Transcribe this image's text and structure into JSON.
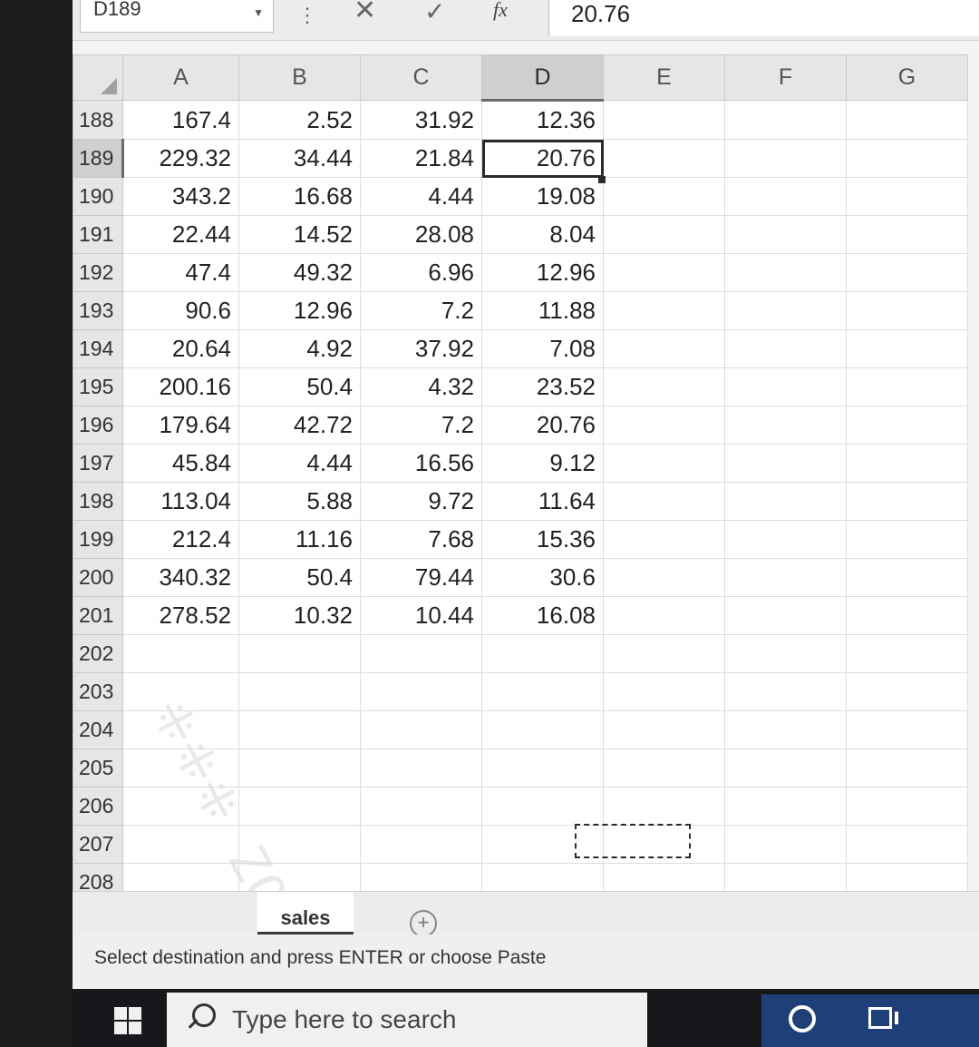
{
  "formula_bar": {
    "name_box": "D189",
    "fx_label": "fx",
    "formula_value": "20.76"
  },
  "columns": [
    "A",
    "B",
    "C",
    "D",
    "E",
    "F",
    "G"
  ],
  "selected_column": "D",
  "selected_row": "189",
  "rows": [
    {
      "row": "188",
      "cells": [
        "167.4",
        "2.52",
        "31.92",
        "12.36"
      ]
    },
    {
      "row": "189",
      "cells": [
        "229.32",
        "34.44",
        "21.84",
        "20.76"
      ]
    },
    {
      "row": "190",
      "cells": [
        "343.2",
        "16.68",
        "4.44",
        "19.08"
      ]
    },
    {
      "row": "191",
      "cells": [
        "22.44",
        "14.52",
        "28.08",
        "8.04"
      ]
    },
    {
      "row": "192",
      "cells": [
        "47.4",
        "49.32",
        "6.96",
        "12.96"
      ]
    },
    {
      "row": "193",
      "cells": [
        "90.6",
        "12.96",
        "7.2",
        "11.88"
      ]
    },
    {
      "row": "194",
      "cells": [
        "20.64",
        "4.92",
        "37.92",
        "7.08"
      ]
    },
    {
      "row": "195",
      "cells": [
        "200.16",
        "50.4",
        "4.32",
        "23.52"
      ]
    },
    {
      "row": "196",
      "cells": [
        "179.64",
        "42.72",
        "7.2",
        "20.76"
      ]
    },
    {
      "row": "197",
      "cells": [
        "45.84",
        "4.44",
        "16.56",
        "9.12"
      ]
    },
    {
      "row": "198",
      "cells": [
        "113.04",
        "5.88",
        "9.72",
        "11.64"
      ]
    },
    {
      "row": "199",
      "cells": [
        "212.4",
        "11.16",
        "7.68",
        "15.36"
      ]
    },
    {
      "row": "200",
      "cells": [
        "340.32",
        "50.4",
        "79.44",
        "30.6"
      ]
    },
    {
      "row": "201",
      "cells": [
        "278.52",
        "10.32",
        "10.44",
        "16.08"
      ]
    },
    {
      "row": "202",
      "cells": [
        "",
        "",
        "",
        ""
      ]
    },
    {
      "row": "203",
      "cells": [
        "",
        "",
        "",
        ""
      ]
    },
    {
      "row": "204",
      "cells": [
        "",
        "",
        "",
        ""
      ]
    },
    {
      "row": "205",
      "cells": [
        "",
        "",
        "",
        ""
      ]
    },
    {
      "row": "206",
      "cells": [
        "",
        "",
        "",
        ""
      ]
    },
    {
      "row": "207",
      "cells": [
        "",
        "",
        "",
        ""
      ]
    },
    {
      "row": "208",
      "cells": [
        "",
        "",
        "",
        ""
      ]
    }
  ],
  "sheet_tabs": {
    "active": "sales",
    "add_symbol": "+"
  },
  "status_bar": {
    "message": "Select destination and press ENTER or choose Paste"
  },
  "taskbar": {
    "search_placeholder": "Type here to search"
  },
  "icons": [
    "windows-start-icon",
    "search-icon",
    "cortana-icon",
    "task-view-icon",
    "cancel-icon",
    "enter-icon",
    "function-icon"
  ]
}
